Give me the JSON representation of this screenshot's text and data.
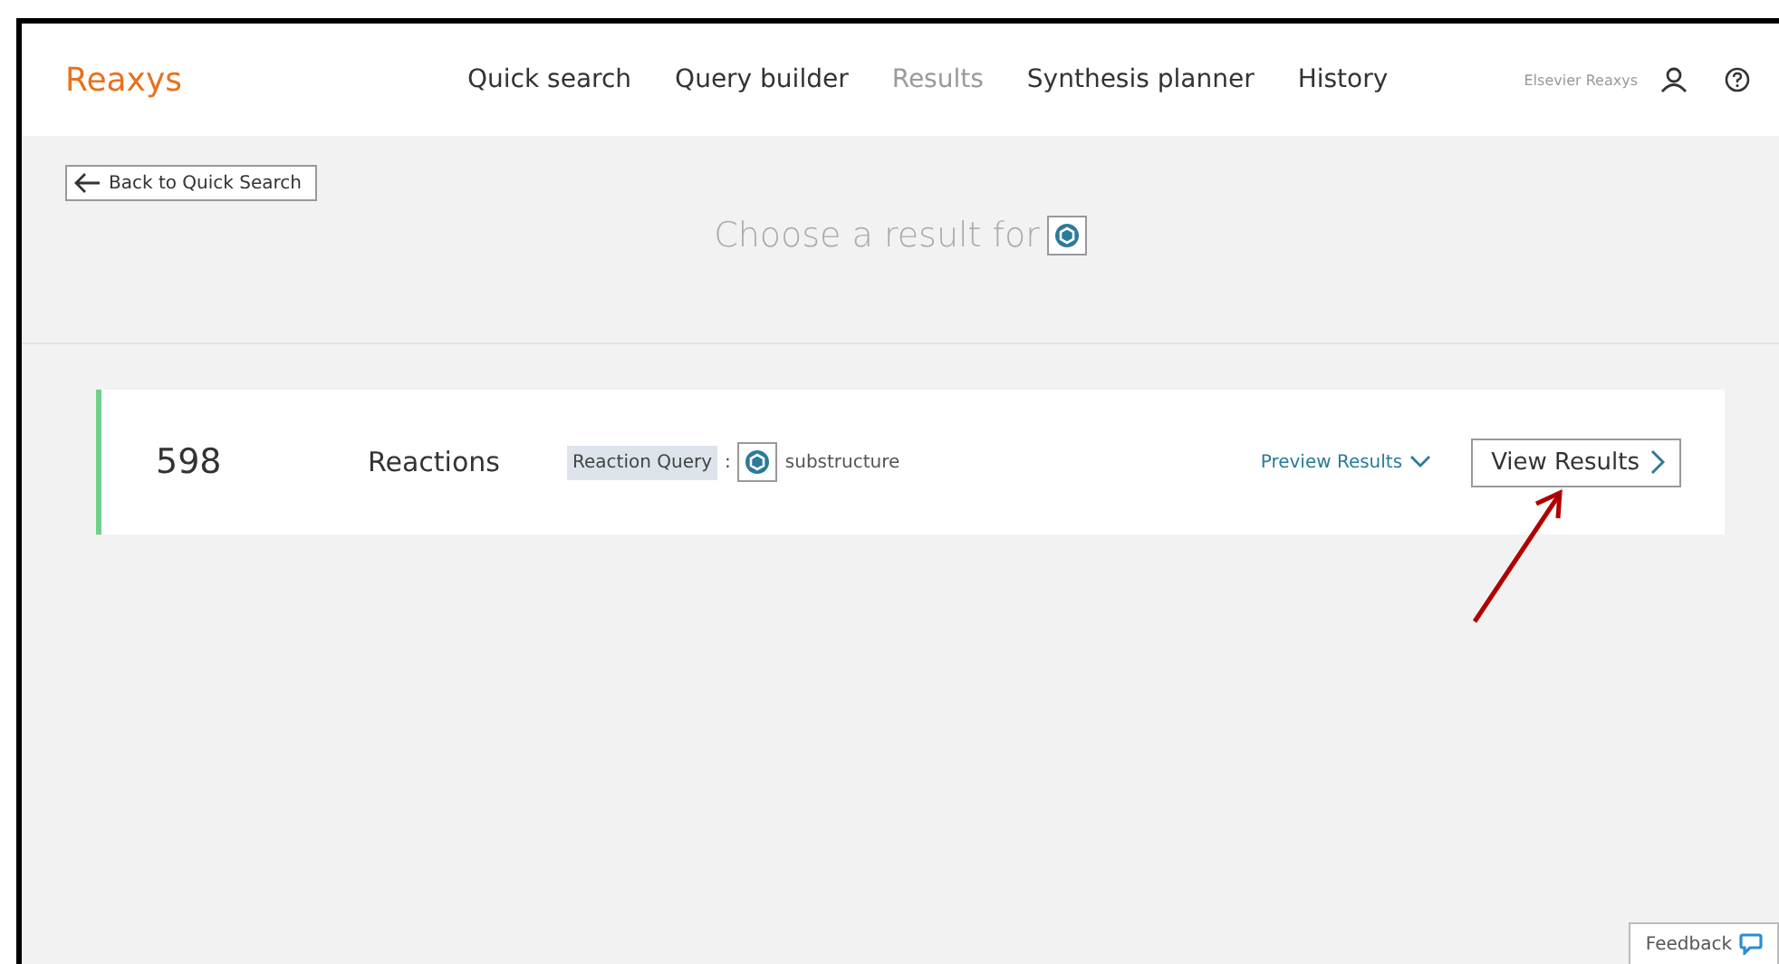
{
  "header": {
    "logo": "Reaxys",
    "nav": [
      {
        "label": "Quick search",
        "selected": false
      },
      {
        "label": "Query builder",
        "selected": false
      },
      {
        "label": "Results",
        "selected": true
      },
      {
        "label": "Synthesis planner",
        "selected": false
      },
      {
        "label": "History",
        "selected": false
      }
    ],
    "account": "Elsevier Reaxys"
  },
  "back_button": "Back to Quick Search",
  "heading": "Choose a result for",
  "results": [
    {
      "count": "598",
      "type": "Reactions",
      "query_tag": "Reaction Query",
      "separator": ":",
      "query_type": "substructure",
      "preview": "Preview Results",
      "view": "View Results"
    }
  ],
  "feedback": "Feedback"
}
